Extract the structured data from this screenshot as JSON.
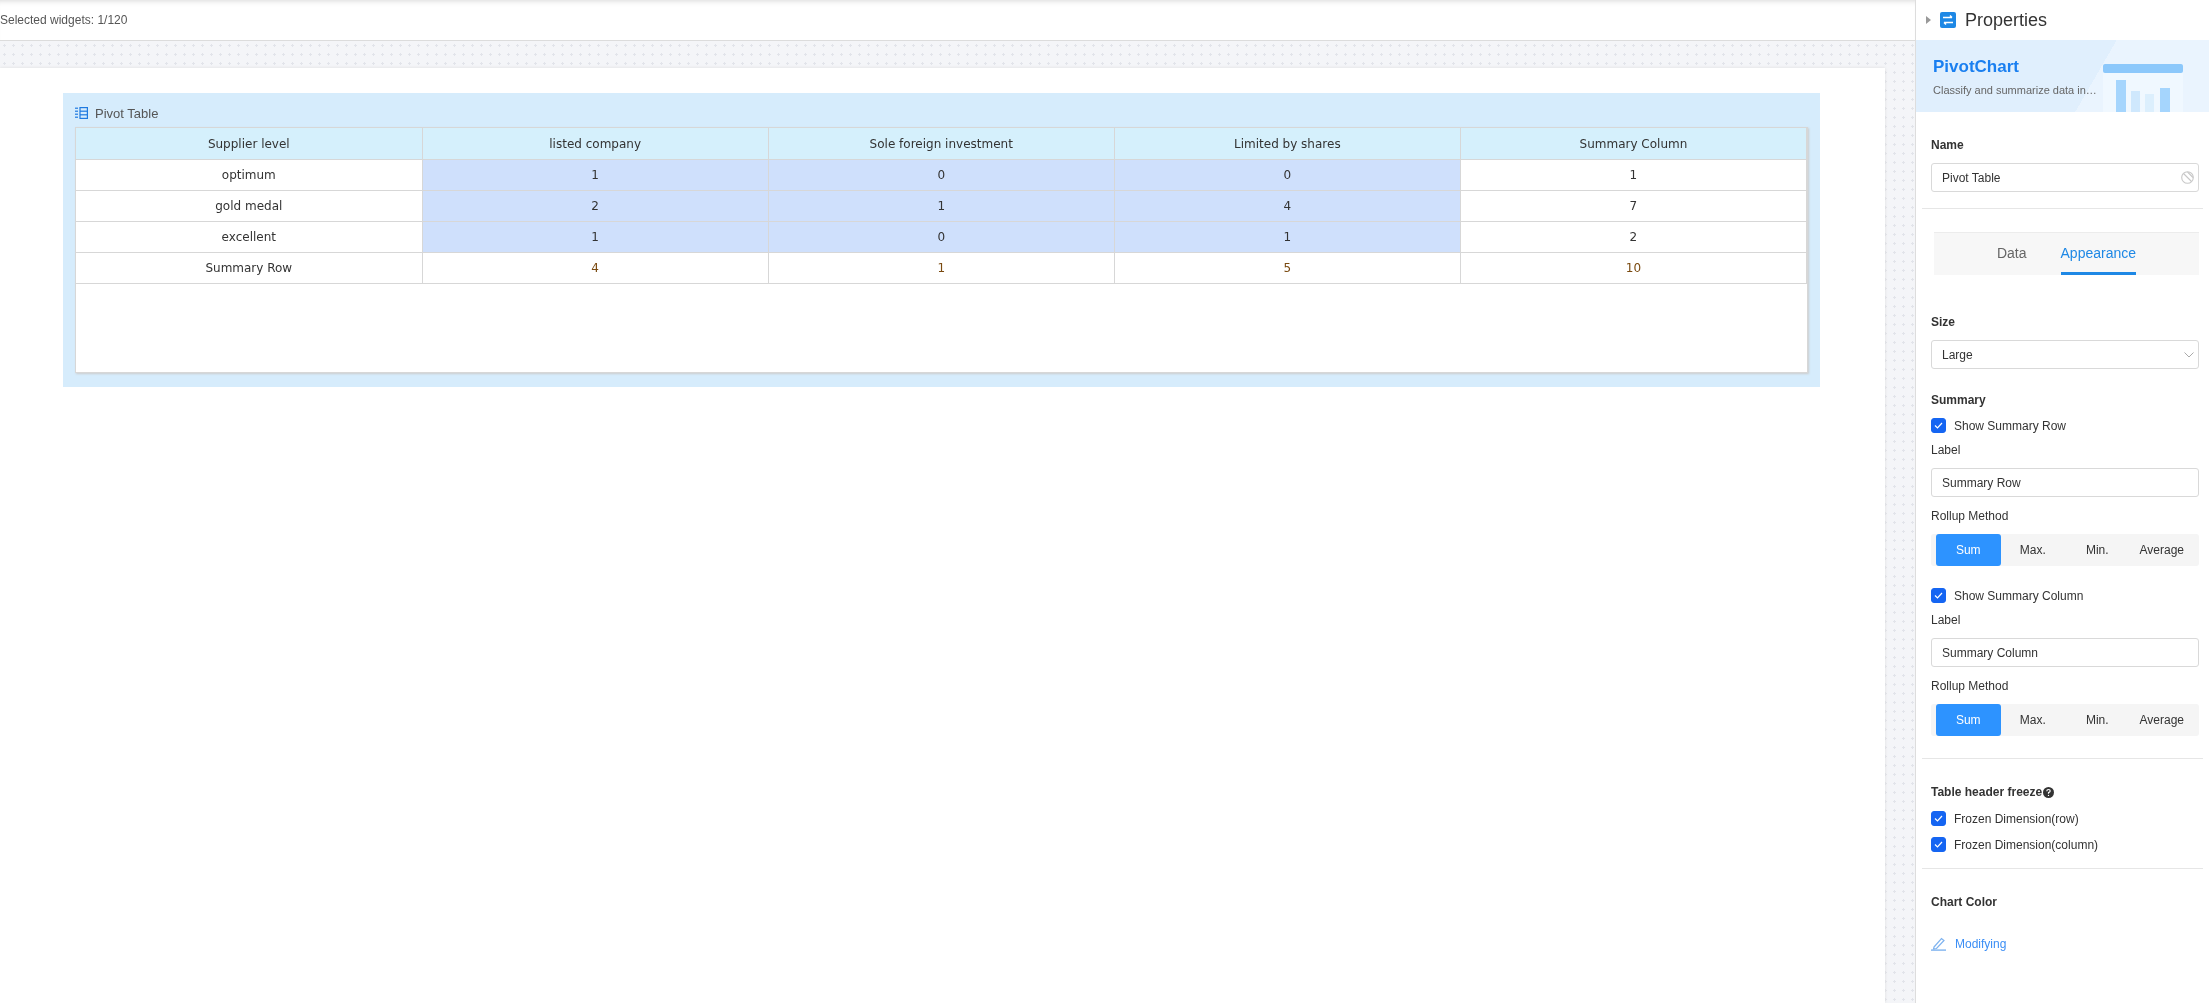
{
  "toolbar": {
    "selection": "Selected widgets: 1/120"
  },
  "widget": {
    "title": "Pivot Table",
    "columns": [
      {
        "label": "Supplier level",
        "kind": "dimension"
      },
      {
        "label": "listed company",
        "kind": "measure"
      },
      {
        "label": "Sole foreign investment",
        "kind": "measure"
      },
      {
        "label": "Limited by shares",
        "kind": "measure"
      },
      {
        "label": "Summary Column",
        "kind": "summary"
      }
    ],
    "rows": [
      {
        "kind": "data",
        "cells": [
          "optimum",
          "1",
          "0",
          "0",
          "1"
        ]
      },
      {
        "kind": "data",
        "cells": [
          "gold medal",
          "2",
          "1",
          "4",
          "7"
        ]
      },
      {
        "kind": "data",
        "cells": [
          "excellent",
          "1",
          "0",
          "1",
          "2"
        ]
      },
      {
        "kind": "summary",
        "cells": [
          "Summary Row",
          "4",
          "1",
          "5",
          "10"
        ]
      }
    ]
  },
  "panel": {
    "title": "Properties",
    "banner": {
      "title": "PivotChart",
      "description": "Classify and summarize data in…"
    },
    "name": {
      "label": "Name",
      "value": "Pivot Table"
    },
    "tabs": [
      {
        "label": "Data",
        "selected": false
      },
      {
        "label": "Appearance",
        "selected": true
      }
    ],
    "size": {
      "label": "Size",
      "value": "Large"
    },
    "summary": {
      "heading": "Summary",
      "sections": [
        {
          "toggle": {
            "label": "Show Summary Row",
            "checked": true
          },
          "label_field": {
            "label": "Label",
            "value": "Summary Row"
          },
          "rollup": {
            "label": "Rollup Method",
            "options": [
              {
                "label": "Sum",
                "selected": true
              },
              {
                "label": "Max.",
                "selected": false
              },
              {
                "label": "Min.",
                "selected": false
              },
              {
                "label": "Average",
                "selected": false
              }
            ]
          }
        },
        {
          "toggle": {
            "label": "Show Summary Column",
            "checked": true
          },
          "label_field": {
            "label": "Label",
            "value": "Summary Column"
          },
          "rollup": {
            "label": "Rollup Method",
            "options": [
              {
                "label": "Sum",
                "selected": true
              },
              {
                "label": "Max.",
                "selected": false
              },
              {
                "label": "Min.",
                "selected": false
              },
              {
                "label": "Average",
                "selected": false
              }
            ]
          }
        }
      ]
    },
    "freeze": {
      "heading": "Table header freeze",
      "options": [
        {
          "label": "Frozen Dimension(row)",
          "checked": true
        },
        {
          "label": "Frozen Dimension(column)",
          "checked": true
        }
      ]
    },
    "chart_color": {
      "heading": "Chart Color",
      "action": "Modifying"
    }
  }
}
